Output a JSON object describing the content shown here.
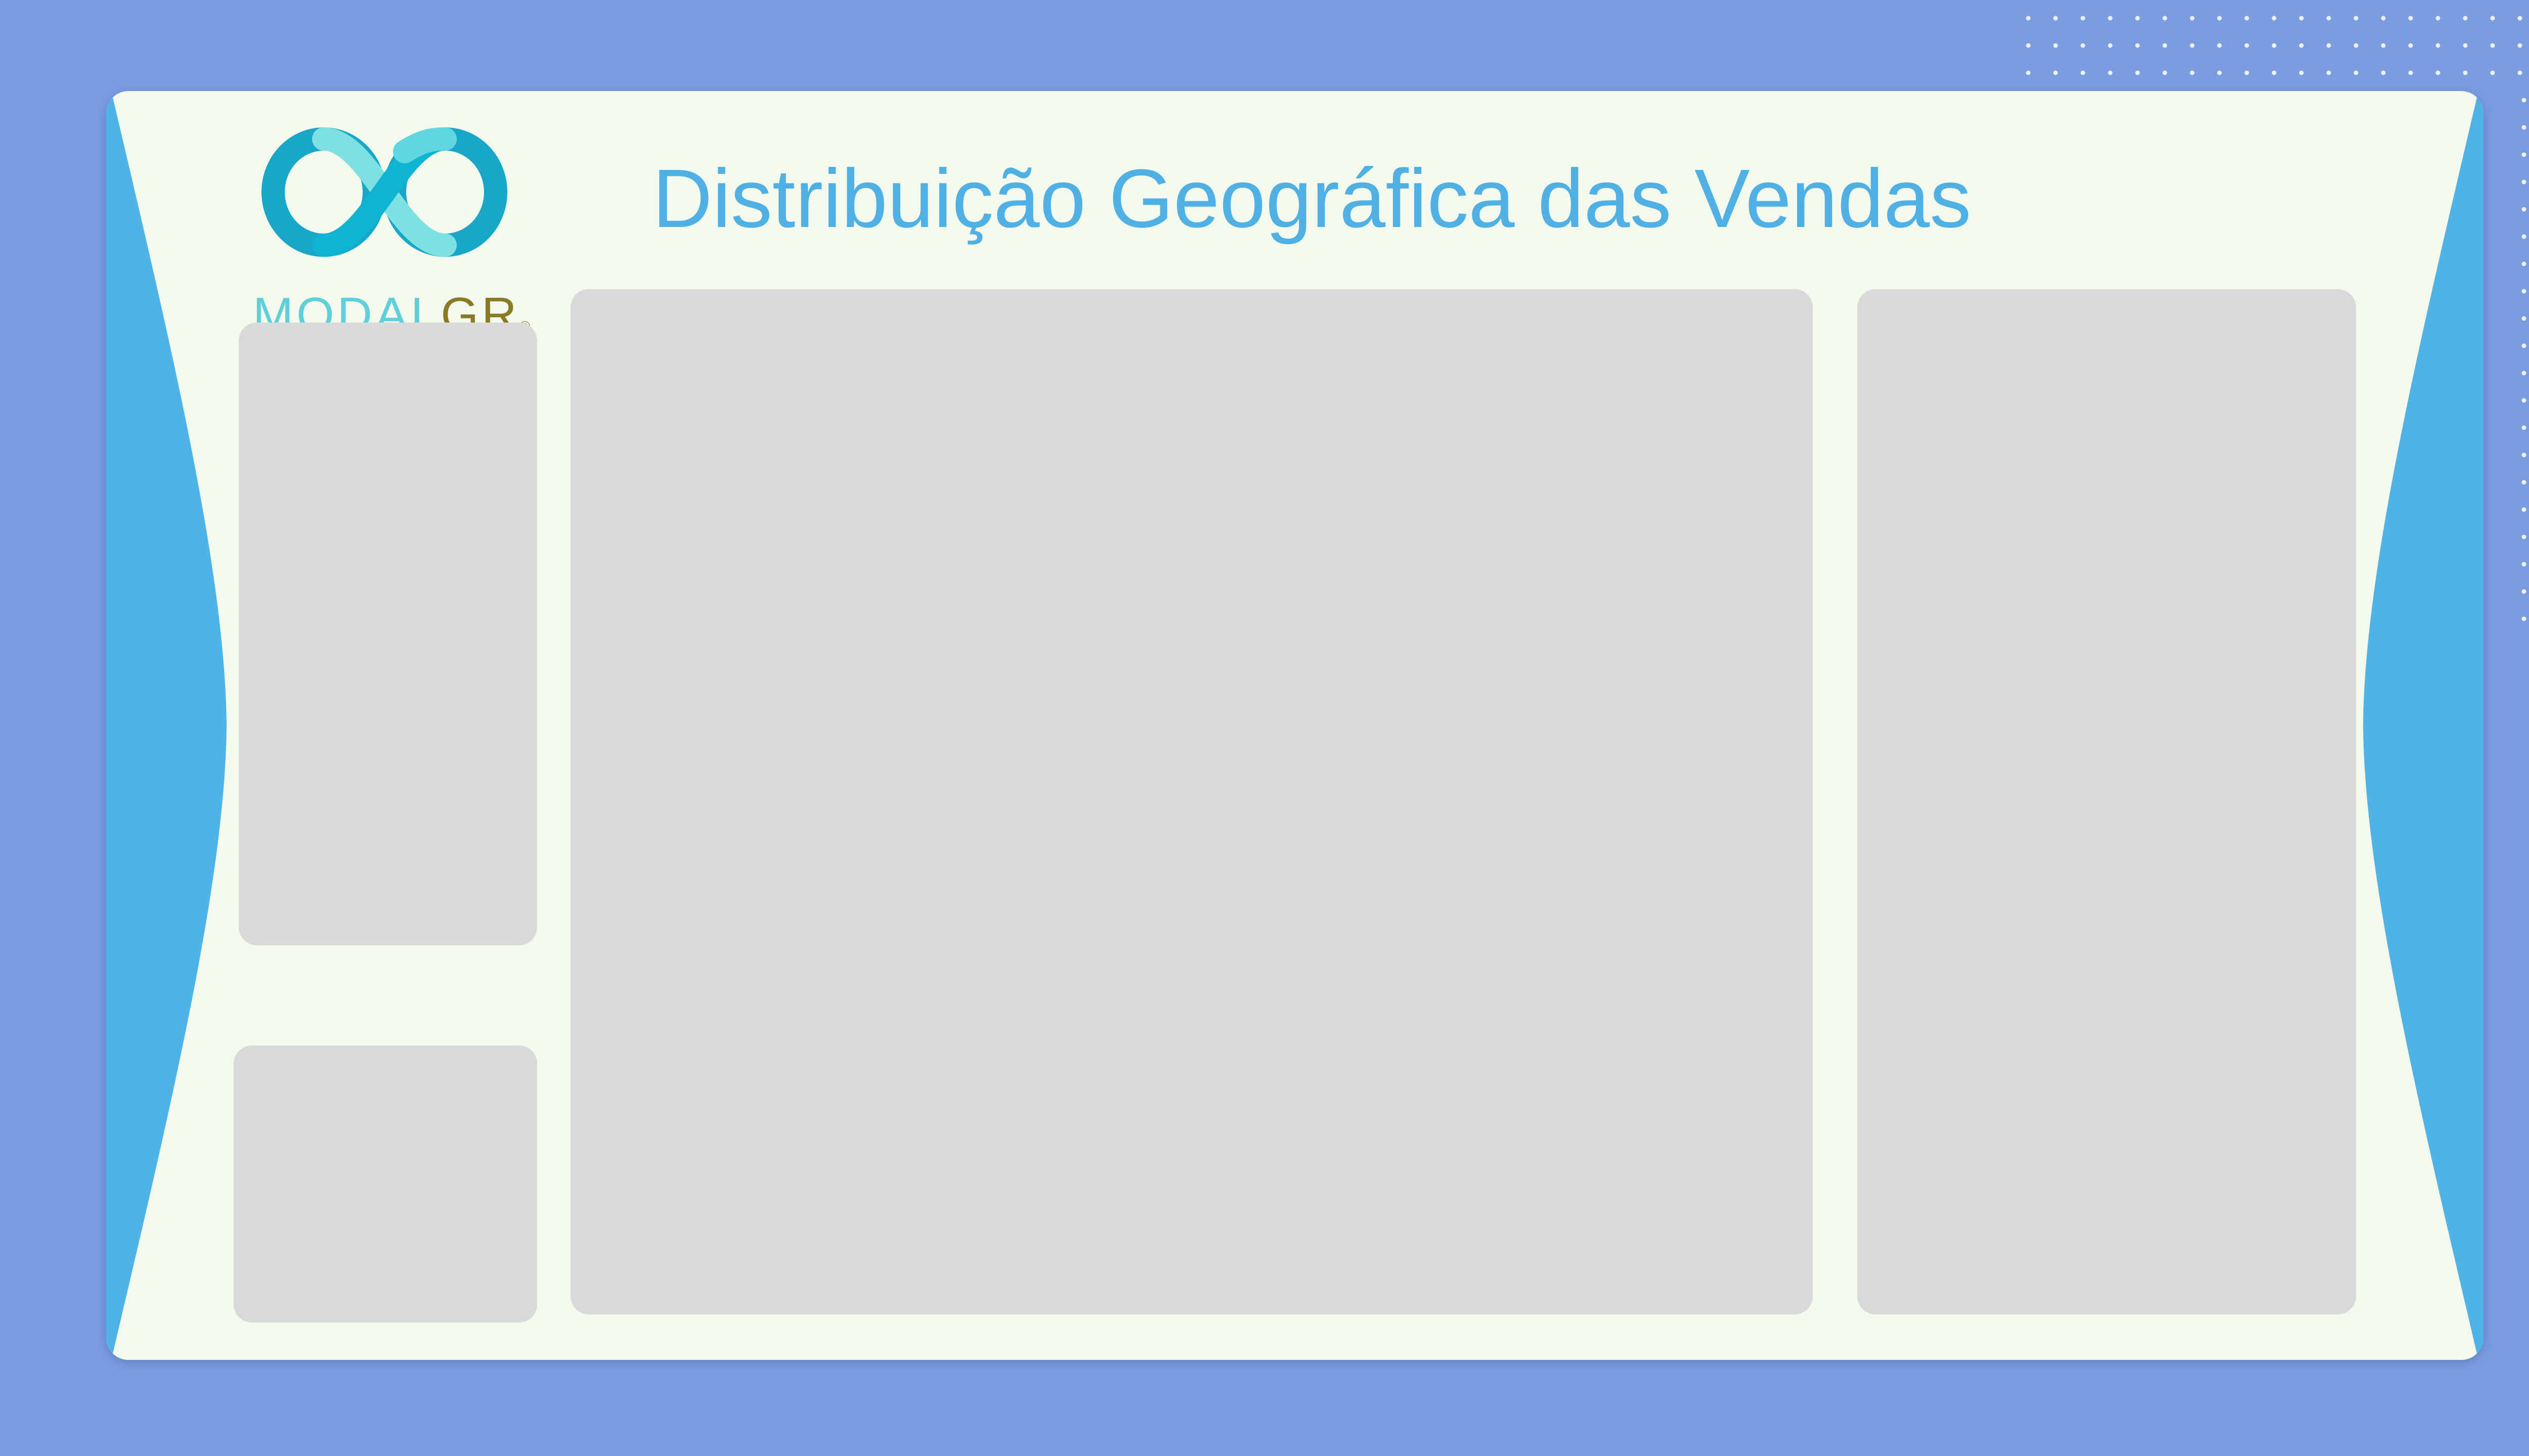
{
  "page": {
    "title": "Distribuição Geográfica das Vendas"
  },
  "logo": {
    "icon": "infinity-icon",
    "word_part_1": "MODAL",
    "word_part_2": "GR",
    "registered_mark": "®"
  },
  "panels": [
    {
      "name": "left-top-panel",
      "content": ""
    },
    {
      "name": "left-bottom-panel",
      "content": ""
    },
    {
      "name": "center-panel",
      "content": ""
    },
    {
      "name": "right-panel",
      "content": ""
    }
  ],
  "colors": {
    "background": "#7b9be3",
    "card": "#f4f9ee",
    "accent_blue": "#4fb3e6",
    "title_blue": "#4fb0e4",
    "panel_gray": "#d9d9d9",
    "logo_teal": "#5fcfd9",
    "logo_gold": "#8b7a25",
    "dots": "#ffffff"
  }
}
